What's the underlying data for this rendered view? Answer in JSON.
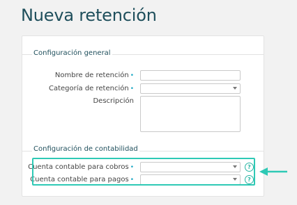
{
  "page": {
    "title": "Nueva retención"
  },
  "sections": {
    "general": {
      "title": "Configuración general",
      "fields": {
        "nombre": {
          "label": "Nombre de retención",
          "value": ""
        },
        "categoria": {
          "label": "Categoría de retención",
          "value": ""
        },
        "descripcion": {
          "label": "Descripción",
          "value": ""
        }
      }
    },
    "contabilidad": {
      "title": "Configuración de contabilidad",
      "fields": {
        "cobros": {
          "label": "Cuenta contable para cobros",
          "value": ""
        },
        "pagos": {
          "label": "Cuenta contable para pagos",
          "value": ""
        }
      }
    }
  },
  "required_marker": "•",
  "help_icon_glyph": "?",
  "colors": {
    "title": "#1f4f5c",
    "required": "#1aa8c4",
    "highlight": "#2ec9b5"
  },
  "icons": {
    "select_caret": "chevron-down-icon",
    "help": "help-circle-icon",
    "annotation_arrow": "arrow-left-icon"
  }
}
